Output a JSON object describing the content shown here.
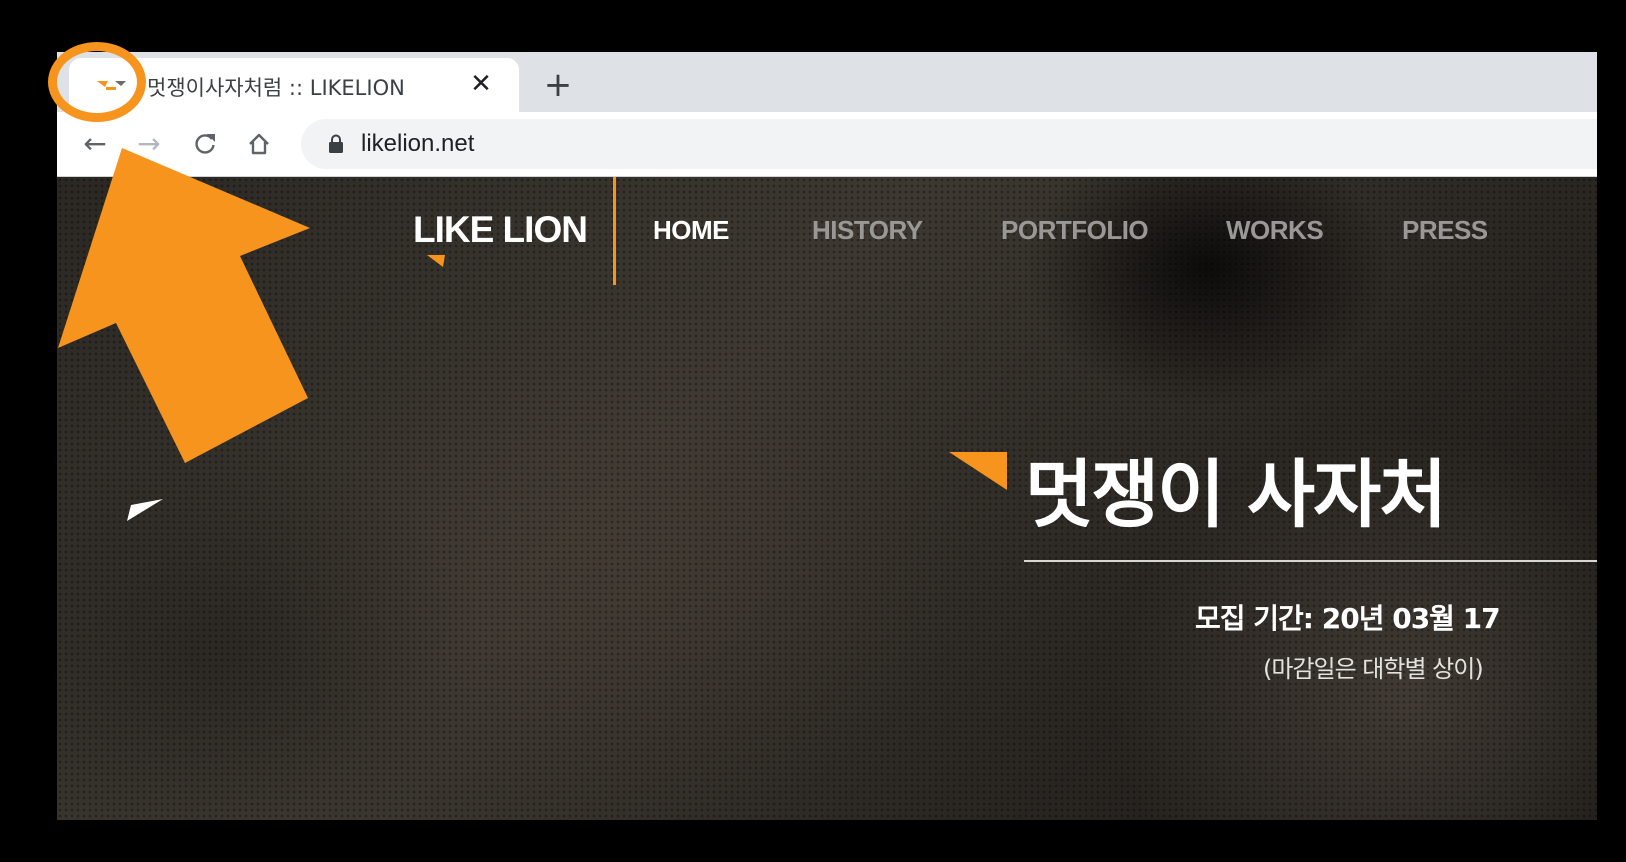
{
  "browser": {
    "tab": {
      "title": "멋쟁이사자처럼 :: LIKELION",
      "close_icon": "close-icon",
      "favicon": "likelion-favicon"
    },
    "new_tab_icon": "plus-icon",
    "toolbar": {
      "back_icon": "arrow-left-icon",
      "forward_icon": "arrow-right-icon",
      "reload_icon": "reload-icon",
      "home_icon": "home-icon",
      "lock_icon": "lock-icon",
      "url": "likelion.net"
    }
  },
  "site": {
    "logo": "LIKE LION",
    "nav": [
      "HOME",
      "HISTORY",
      "PORTFOLIO",
      "WORKS",
      "PRESS"
    ],
    "active_nav": "HOME",
    "hero": {
      "title": "멋쟁이 사자처",
      "recruit_period": "모집 기간: 20년 03월 17",
      "deadline_note": "(마감일은 대학별 상이)"
    }
  },
  "annotation": {
    "color": "#f7941d",
    "shapes": [
      "highlight-circle",
      "pointer-arrow"
    ]
  },
  "colors": {
    "brand_orange": "#f7941d",
    "tabstrip": "#dee1e6",
    "omnibox": "#f1f3f4"
  }
}
